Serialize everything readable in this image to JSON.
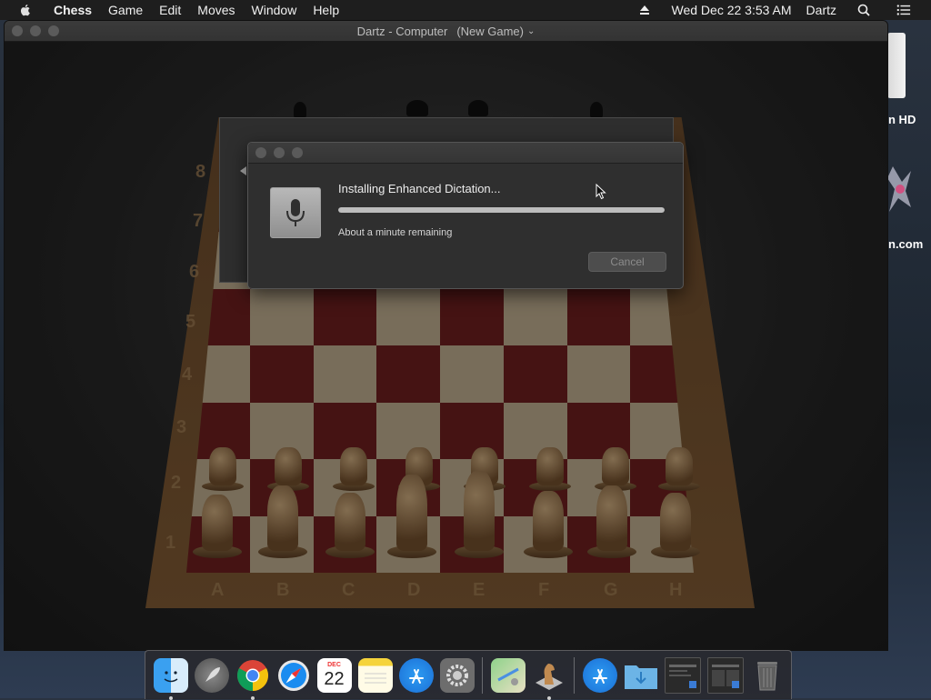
{
  "menubar": {
    "app_name": "Chess",
    "items": [
      "Game",
      "Edit",
      "Moves",
      "Window",
      "Help"
    ],
    "datetime": "Wed Dec 22  3:53 AM",
    "user": "Dartz"
  },
  "desktop": {
    "drive_label": "n HD",
    "network_label": "n.com"
  },
  "window": {
    "title": "Dartz - Computer",
    "subtitle": "(New Game)"
  },
  "board": {
    "ranks": [
      "8",
      "7",
      "6",
      "5",
      "4",
      "3",
      "2",
      "1"
    ],
    "files": [
      "A",
      "B",
      "C",
      "D",
      "E",
      "F",
      "G",
      "H"
    ]
  },
  "dialog": {
    "heading": "Installing Enhanced Dictation...",
    "progress": 1.0,
    "status": "About a minute remaining",
    "cancel_label": "Cancel"
  },
  "dock": {
    "items": [
      {
        "name": "finder",
        "running": true
      },
      {
        "name": "launchpad",
        "running": false
      },
      {
        "name": "chrome",
        "running": true
      },
      {
        "name": "safari",
        "running": false
      },
      {
        "name": "calendar",
        "running": false,
        "month": "DEC",
        "day": "22"
      },
      {
        "name": "notes",
        "running": false
      },
      {
        "name": "app-store",
        "running": false
      },
      {
        "name": "system-preferences",
        "running": false
      },
      {
        "name": "maps",
        "running": false
      },
      {
        "name": "chess",
        "running": true
      },
      {
        "name": "applications-folder",
        "running": false
      },
      {
        "name": "downloads-folder",
        "running": false
      },
      {
        "name": "window-thumbnail-1",
        "running": false
      },
      {
        "name": "window-thumbnail-2",
        "running": false
      },
      {
        "name": "trash",
        "running": false
      }
    ]
  },
  "colors": {
    "menubar_bg": "#1e1e1e",
    "board_dark": "#6a1e1e",
    "board_light": "#b8a88a"
  }
}
